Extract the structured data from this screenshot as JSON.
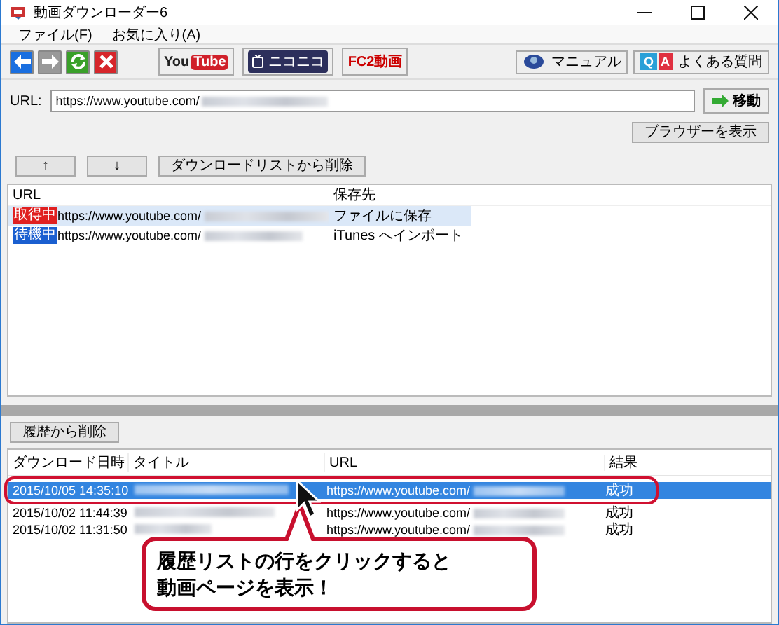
{
  "window": {
    "title": "動画ダウンローダー6"
  },
  "menu": [
    "ファイル(F)",
    "お気に入り(A)"
  ],
  "toolbar": {
    "sites": [
      {
        "kind": "youtube",
        "parts": [
          "You",
          "Tube"
        ]
      },
      {
        "kind": "niconico",
        "parts": [
          "ニコニコ"
        ]
      },
      {
        "kind": "fc2",
        "parts": [
          "FC2動画"
        ]
      }
    ],
    "manual": "マニュアル",
    "faq": {
      "label": "よくある質問",
      "letters": [
        "Q",
        "A"
      ]
    }
  },
  "url_bar": {
    "label": "URL:",
    "value": "https://www.youtube.com/",
    "go": "移動"
  },
  "show_browser": "ブラウザーを表示",
  "list_buttons": [
    "↑",
    "↓",
    "ダウンロードリストから削除"
  ],
  "download_list": {
    "columns": [
      "URL",
      "保存先"
    ],
    "rows": [
      {
        "status": "取得中",
        "kind": "fetching",
        "url": "https://www.youtube.com/",
        "destination": "ファイルに保存",
        "selected": true
      },
      {
        "status": "待機中",
        "kind": "waiting",
        "url": "https://www.youtube.com/",
        "destination": "iTunes へインポート",
        "selected": false
      }
    ]
  },
  "delete_history": "履歴から削除",
  "history": {
    "columns": [
      "ダウンロード日時",
      "タイトル",
      "URL",
      "結果"
    ],
    "rows": [
      {
        "date": "2015/10/05 14:35:10",
        "url": "https://www.youtube.com/",
        "result": "成功",
        "selected": true
      },
      {
        "date": "2015/10/02 11:44:39",
        "url": "https://www.youtube.com/",
        "result": "成功",
        "selected": false
      },
      {
        "date": "2015/10/02 11:31:50",
        "url": "https://www.youtube.com/",
        "result": "成功",
        "selected": false
      }
    ]
  },
  "callout": [
    "履歴リストの行をクリックすると",
    "動画ページを表示！"
  ]
}
